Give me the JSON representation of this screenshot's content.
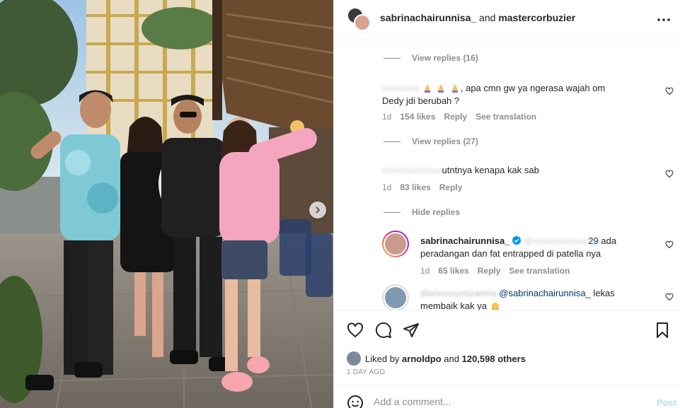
{
  "header": {
    "user1": "sabrinachairunnisa_",
    "and_text": " and ",
    "user2": "mastercorbuzier"
  },
  "comments": {
    "view_replies_1": "View replies (16)",
    "comment1": {
      "text_after_emoji": ", apa cmn gw ya ngerasa wajah om",
      "text_line2": "Dedy jdi berubah ?",
      "age": "1d",
      "likes": "154 likes",
      "reply": "Reply",
      "translate": "See translation"
    },
    "view_replies_2": "View replies (27)",
    "comment2": {
      "text": "utntnya kenapa kak sab",
      "age": "1d",
      "likes": "83 likes",
      "reply": "Reply"
    },
    "hide_replies": "Hide replies",
    "reply1": {
      "username": "sabrinachairunnisa_",
      "mention_suffix": "29",
      "text_after": " ada",
      "text_line2": "peradangan dan fat entrapped di patella nya",
      "age": "1d",
      "likes": "65 likes",
      "reply": "Reply",
      "translate": "See translation"
    },
    "reply2": {
      "username": "dianrouumizanna",
      "mention": "@sabrinachairunnisa_",
      "text_after": " lekas",
      "text_line2": "membaik kak ya"
    }
  },
  "actions": {
    "liked_by_prefix": "Liked by ",
    "liked_by_user": "arnoldpo",
    "liked_by_and": " and ",
    "liked_by_others": "120,598 others",
    "date": "1 DAY AGO"
  },
  "add_comment": {
    "placeholder": "Add a comment...",
    "post_label": "Post"
  },
  "colors": {
    "link_blue": "#00376b",
    "post_disabled": "#b2dffc",
    "muted": "#8e8e8e",
    "hoodie_pink": "#f4a6c0"
  }
}
